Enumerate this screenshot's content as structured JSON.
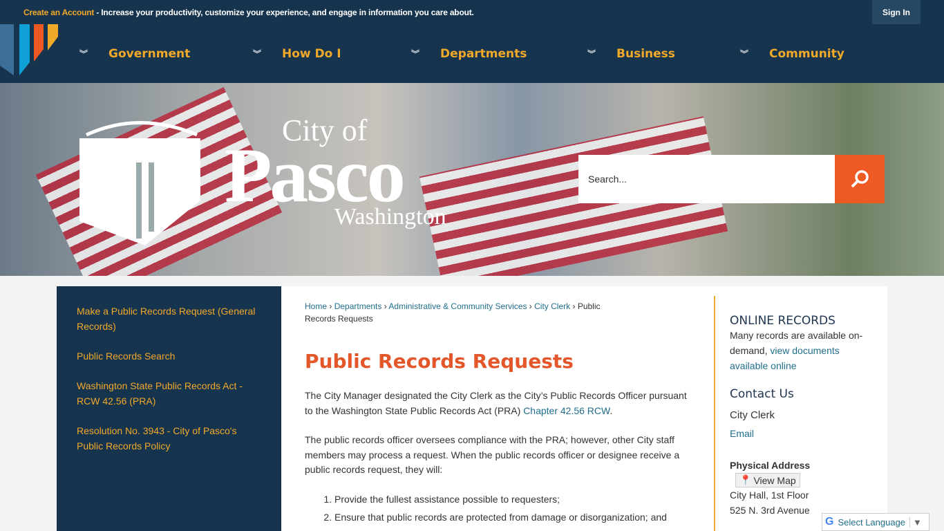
{
  "topbar": {
    "create_account": "Create an Account",
    "message": " - Increase your productivity, customize your experience, and engage in information you care about.",
    "sign_in": "Sign In"
  },
  "nav": [
    {
      "label": "Government"
    },
    {
      "label": "How Do I"
    },
    {
      "label": "Departments"
    },
    {
      "label": "Business"
    },
    {
      "label": "Community"
    }
  ],
  "logo": {
    "city": "City of",
    "name": "Pasco",
    "state": "Washington"
  },
  "search": {
    "placeholder": "Search..."
  },
  "sidebar": {
    "items": [
      {
        "label": "Make a Public Records Request (General Records)"
      },
      {
        "label": "Public Records Search"
      },
      {
        "label": "Washington State Public Records Act - RCW 42.56 (PRA)"
      },
      {
        "label": "Resolution No. 3943 - City of Pasco's Public Records Policy"
      }
    ]
  },
  "breadcrumb": {
    "items": [
      "Home",
      "Departments",
      "Administrative & Community Services",
      "City Clerk"
    ],
    "current": "Public Records Requests"
  },
  "page": {
    "title": "Public Records Requests",
    "p1": "The City Manager designated the City Clerk as the City’s Public Records Officer pursuant to the Washington State Public Records Act (PRA) ",
    "p1_link": "Chapter 42.56 RCW",
    "p2": "The public records officer oversees compliance with the PRA; however, other City staff members may process a request. When the public records officer or designee receive a public records request, they will:",
    "list": [
      "Provide the fullest assistance possible to requesters;",
      "Ensure that public records are protected from damage or disorganization; and"
    ]
  },
  "right": {
    "online_title": "ONLINE RECORDS",
    "online_text": "Many records are available on-demand, ",
    "online_link": "view documents available online",
    "contact_title": "Contact Us",
    "contact_name": "City Clerk",
    "email": "Email",
    "address_label": "Physical Address",
    "view_map": "View Map",
    "address1": "City Hall, 1st Floor",
    "address2": "525 N. 3rd Avenue"
  },
  "translate": {
    "label": "Select Language"
  },
  "colors": {
    "navy": "#17344e",
    "gold": "#f1a92a",
    "orange": "#ef5a24",
    "link": "#1f6e8c"
  }
}
